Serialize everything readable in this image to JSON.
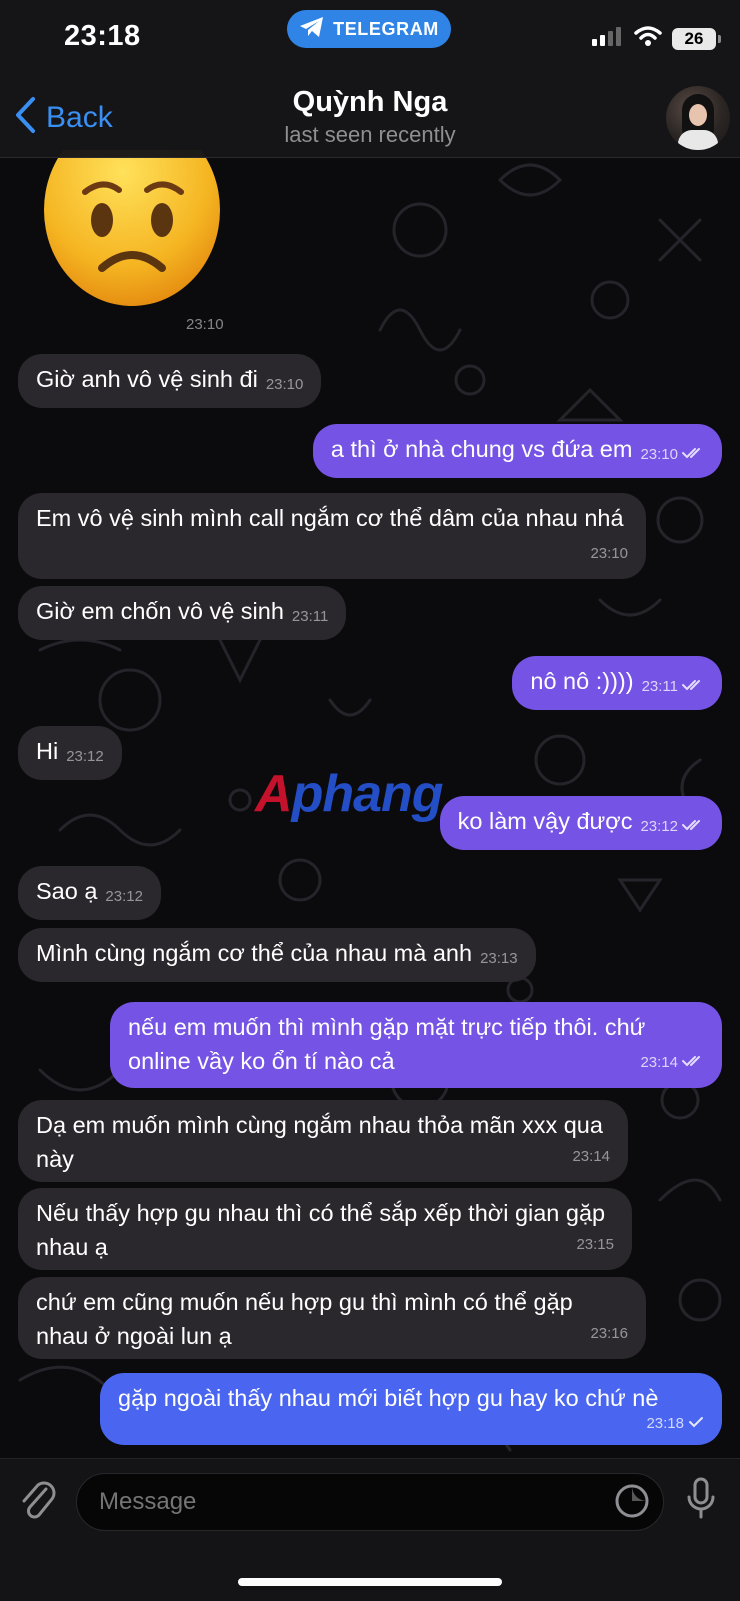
{
  "status_bar": {
    "time": "23:18",
    "pill_label": "TELEGRAM",
    "battery": "26"
  },
  "header": {
    "back_label": "Back",
    "contact_name": "Quỳnh Nga",
    "last_seen": "last seen recently"
  },
  "sticker": {
    "emoji": "😟",
    "time": "23:10"
  },
  "messages": [
    {
      "dir": "in",
      "text": "Giờ anh vô vệ sinh đi",
      "time": "23:10"
    },
    {
      "dir": "out",
      "text": "a thì ở nhà chung vs đứa em",
      "time": "23:10",
      "read": "double"
    },
    {
      "dir": "in",
      "text": "Em vô vệ sinh mình call ngắm cơ thể dâm của nhau nhá",
      "time": "23:10"
    },
    {
      "dir": "in",
      "text": "Giờ em chốn vô vệ sinh",
      "time": "23:11"
    },
    {
      "dir": "out",
      "text": "nô nô :))))",
      "time": "23:11",
      "read": "double"
    },
    {
      "dir": "in",
      "text": "Hi",
      "time": "23:12"
    },
    {
      "dir": "out",
      "text": "ko làm vậy được",
      "time": "23:12",
      "read": "double"
    },
    {
      "dir": "in",
      "text": "Sao ạ",
      "time": "23:12"
    },
    {
      "dir": "in",
      "text": "Mình cùng ngắm cơ thể của nhau mà anh",
      "time": "23:13"
    },
    {
      "dir": "out",
      "text": "nếu em muốn thì mình gặp mặt trực tiếp thôi. chứ online vầy ko ổn tí nào cả",
      "time": "23:14",
      "read": "double"
    },
    {
      "dir": "in",
      "text": "Dạ em muốn mình cùng ngắm nhau thỏa mãn xxx qua này",
      "time": "23:14"
    },
    {
      "dir": "in",
      "text": "Nếu thấy hợp gu nhau thì có thể sắp xếp thời gian gặp nhau ạ",
      "time": "23:15"
    },
    {
      "dir": "in",
      "text": "chứ em cũng muốn nếu hợp gu thì mình có thể gặp nhau ở ngoài lun ạ",
      "time": "23:16"
    },
    {
      "dir": "out",
      "text": "gặp ngoài thấy nhau mới biết hợp gu hay ko chứ nè",
      "time": "23:18",
      "read": "single"
    }
  ],
  "watermark": {
    "first": "A",
    "rest": "phang"
  },
  "composer": {
    "placeholder": "Message"
  },
  "colors": {
    "accent": "#3a8ff3",
    "outgoing": "#7553e4",
    "incoming": "#2b282d",
    "telegram_pill": "#2f84e6"
  },
  "icons": [
    "telegram-icon",
    "signal-icon",
    "wifi-icon",
    "battery-icon",
    "back-chevron-icon",
    "paperclip-icon",
    "sticker-icon",
    "microphone-icon",
    "double-check-icon",
    "single-check-icon"
  ]
}
